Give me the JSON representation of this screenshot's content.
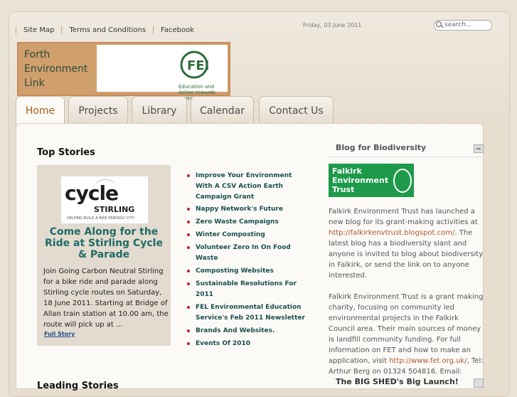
{
  "topnav": [
    "Site Map",
    "Terms and Conditions",
    "Facebook"
  ],
  "date": "Friday, 03 June 2011",
  "search_placeholder": "search...",
  "logo": {
    "line1": "Forth",
    "line2": "Environment",
    "line3": "Link",
    "tagline": "Education and Action towards Sustainable Living"
  },
  "tabs": [
    "Home",
    "Projects",
    "Library",
    "Calendar",
    "Contact Us"
  ],
  "top_stories": {
    "heading": "Top Stories",
    "cycle_logo": {
      "big": "cycle",
      "small": "STIRLING",
      "tag": "HELPING BUILD A BIKE-FRIENDLY CITY"
    },
    "title": "Come Along for the Ride at Stirling Cycle & Parade",
    "body": "Join Going Carbon Neutral Stirling for a bike ride and parade along Stirling cycle routes on Saturday, 18 June 2011. Starting at Bridge of Allan train station at 10.00 am, the route will pick up at ...",
    "full_story": "Full Story"
  },
  "links": [
    "Improve Your Environment With A CSV Action Earth Campaign Grant",
    "Nappy Network's Future",
    "Zero Waste Campaigns",
    "Winter Composting",
    "Volunteer Zero In On Food Waste",
    "Composting Websites",
    "Sustainable Resolutions For 2011",
    "FEL Environmental Education Service's Feb 2011 Newsletter",
    "Brands And Websites.",
    "Events Of 2010"
  ],
  "blog": {
    "heading": "Blog for Biodiversity",
    "fet_logo": [
      "Falkirk",
      "Environment",
      "Trust"
    ],
    "p1_a": "Falkirk Environment Trust has launched a new blog for its grant-making activities at ",
    "p1_link": "http://falkirkenvtrust.blogspot.com/",
    "p1_b": ". The latest blog has a biodiversity slant and anyone is invited to blog about biodiversity in Falkirk, or send the link on to anyone interested.",
    "p2_a": "Falkirk Environment Trust is a grant making charity, focusing on community led environmental projects in the Falkirk Council area. Their main sources of money is landfill community funding. For full information on FET and how to make an application, visit ",
    "p2_link": "http://www.fet.org.uk/",
    "p2_b": ", Tel: Arthur Berg on 01324 504816. Email:"
  },
  "shed_heading": "The BIG SHED's Big Launch!",
  "leading_heading": "Leading Stories"
}
